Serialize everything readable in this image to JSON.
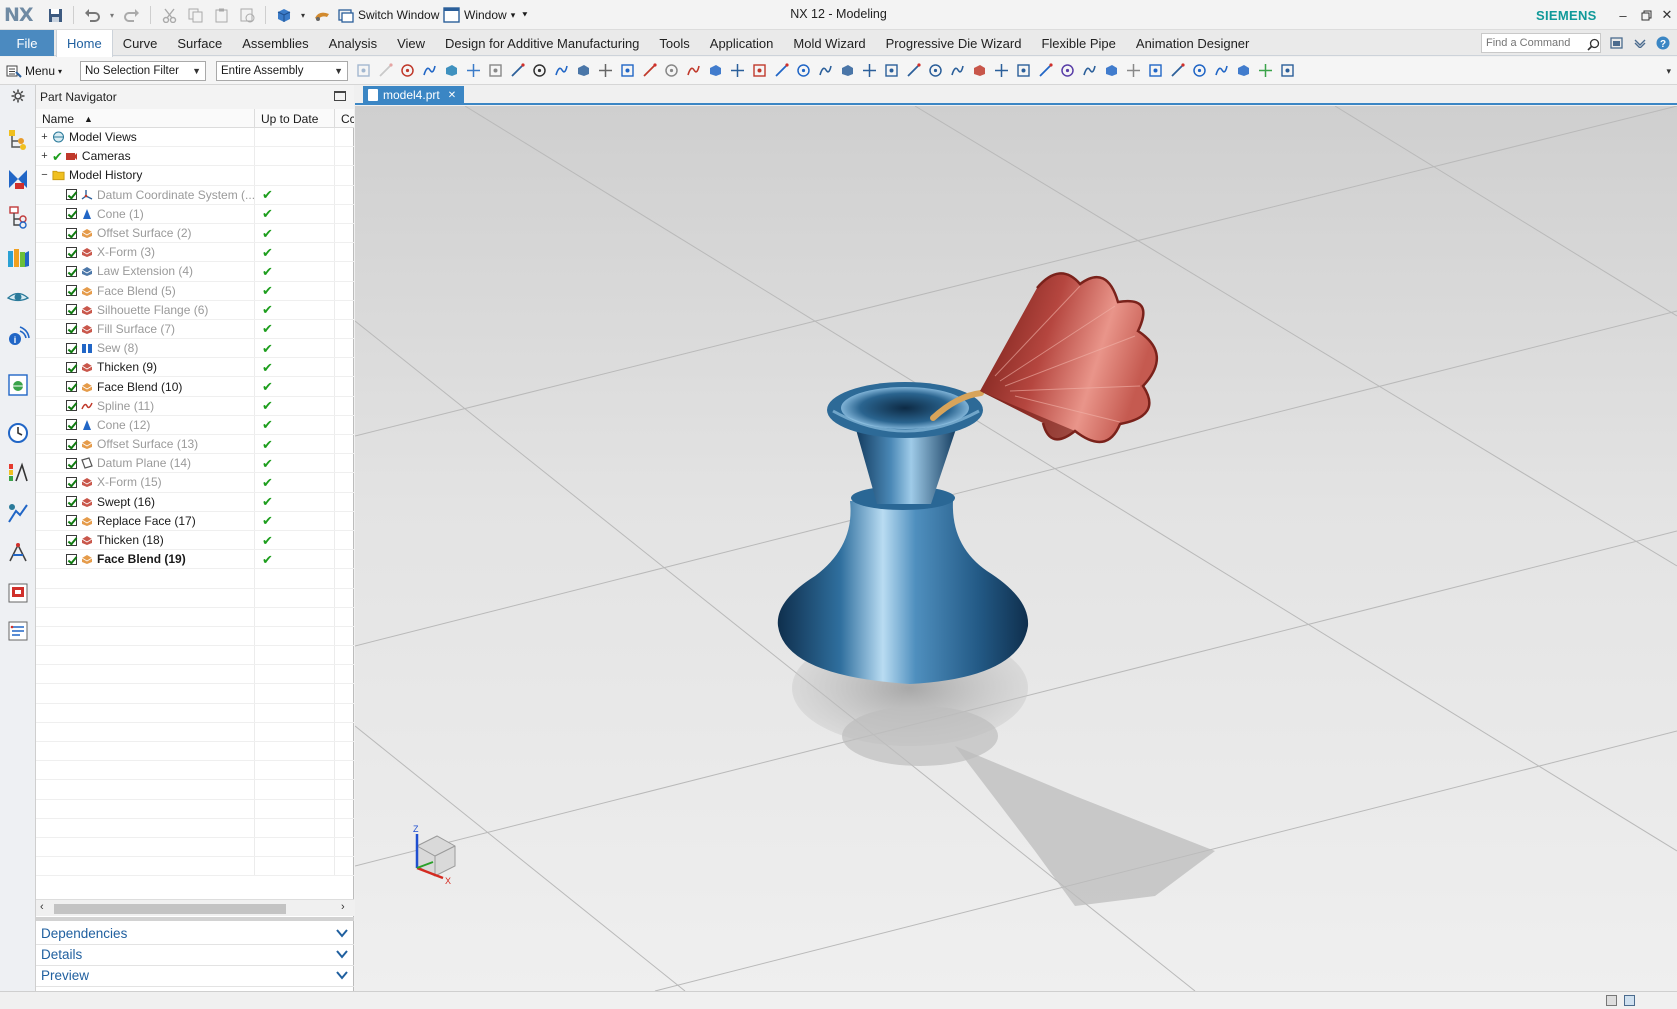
{
  "app": {
    "logo": "NX",
    "title": "NX 12 - Modeling",
    "brand": "SIEMENS",
    "switch_window": "Switch Window",
    "window_menu": "Window"
  },
  "ribbon": {
    "file_label": "File",
    "tabs": [
      {
        "label": "Home",
        "active": true
      },
      {
        "label": "Curve"
      },
      {
        "label": "Surface"
      },
      {
        "label": "Assemblies"
      },
      {
        "label": "Analysis"
      },
      {
        "label": "View"
      },
      {
        "label": "Design for Additive Manufacturing"
      },
      {
        "label": "Tools"
      },
      {
        "label": "Application"
      },
      {
        "label": "Mold Wizard"
      },
      {
        "label": "Progressive Die Wizard"
      },
      {
        "label": "Flexible Pipe"
      },
      {
        "label": "Animation Designer"
      }
    ],
    "command_search_placeholder": "Find a Command"
  },
  "toolbar": {
    "menu_label": "Menu",
    "selection_filter": "No Selection Filter",
    "scope": "Entire Assembly"
  },
  "navigator": {
    "title": "Part Navigator",
    "columns": {
      "name": "Name",
      "up_to_date": "Up to Date",
      "comment": "Cc"
    },
    "groups": [
      {
        "label": "Model Views",
        "expander": "+"
      },
      {
        "label": "Cameras",
        "expander": "+"
      },
      {
        "label": "Model History",
        "expander": "−"
      }
    ],
    "features": [
      {
        "label": "Datum Coordinate System (...",
        "state": "grey",
        "icon": "datum-csys-icon"
      },
      {
        "label": "Cone (1)",
        "state": "grey",
        "icon": "cone-icon"
      },
      {
        "label": "Offset Surface (2)",
        "state": "grey",
        "icon": "offset-surface-icon"
      },
      {
        "label": "X-Form (3)",
        "state": "grey",
        "icon": "xform-icon"
      },
      {
        "label": "Law Extension (4)",
        "state": "grey",
        "icon": "law-extension-icon"
      },
      {
        "label": "Face Blend (5)",
        "state": "grey",
        "icon": "face-blend-icon"
      },
      {
        "label": "Silhouette Flange (6)",
        "state": "grey",
        "icon": "silhouette-flange-icon"
      },
      {
        "label": "Fill Surface (7)",
        "state": "grey",
        "icon": "fill-surface-icon"
      },
      {
        "label": "Sew (8)",
        "state": "grey",
        "icon": "sew-icon"
      },
      {
        "label": "Thicken (9)",
        "state": "normal",
        "icon": "thicken-icon"
      },
      {
        "label": "Face Blend (10)",
        "state": "normal",
        "icon": "face-blend-icon"
      },
      {
        "label": "Spline (11)",
        "state": "grey",
        "icon": "spline-icon"
      },
      {
        "label": "Cone (12)",
        "state": "grey",
        "icon": "cone-icon"
      },
      {
        "label": "Offset Surface (13)",
        "state": "grey",
        "icon": "offset-surface-icon"
      },
      {
        "label": "Datum Plane (14)",
        "state": "grey",
        "icon": "datum-plane-icon"
      },
      {
        "label": "X-Form (15)",
        "state": "grey",
        "icon": "xform-icon"
      },
      {
        "label": "Swept (16)",
        "state": "normal",
        "icon": "swept-icon"
      },
      {
        "label": "Replace Face (17)",
        "state": "normal",
        "icon": "replace-face-icon"
      },
      {
        "label": "Thicken (18)",
        "state": "normal",
        "icon": "thicken-icon"
      },
      {
        "label": "Face Blend (19)",
        "state": "bold",
        "icon": "face-blend-icon"
      }
    ],
    "panels": [
      "Dependencies",
      "Details",
      "Preview"
    ]
  },
  "graphics": {
    "tab_label": "model4.prt",
    "tab_close": "✕",
    "triad": {
      "z": "Z",
      "x": "X"
    }
  },
  "colors": {
    "accent": "#3b86c4",
    "file_tab": "#4b8ac0",
    "brand": "#109999",
    "vase_body": "#2f6f9e",
    "flare": "#b5463f",
    "check": "#1d9e1d"
  }
}
